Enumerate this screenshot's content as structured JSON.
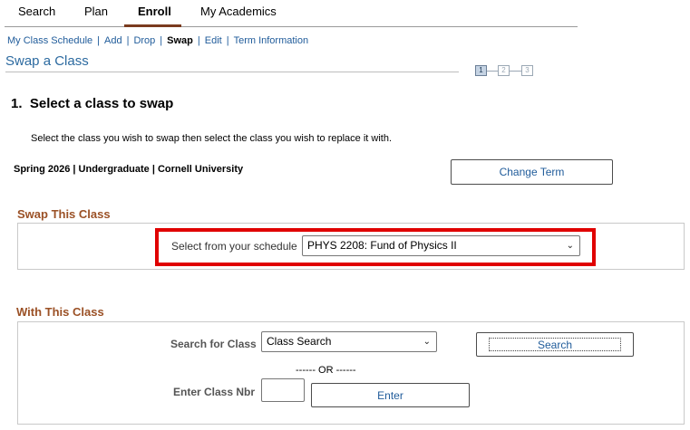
{
  "tabs": [
    {
      "label": "Search",
      "underline_char": "h"
    },
    {
      "label": "Plan"
    },
    {
      "label": "Enroll",
      "active": true
    },
    {
      "label": "My Academics"
    }
  ],
  "subnav": {
    "my_class_schedule": "My Class Schedule",
    "add": "Add",
    "drop": "Drop",
    "swap": "Swap",
    "edit": "Edit",
    "term_information": "Term Information",
    "separator": "|"
  },
  "page_title": "Swap a Class",
  "steps": [
    "1",
    "2",
    "3"
  ],
  "current_step": 1,
  "heading": "1.  Select a class to swap",
  "instruction": "Select the class you wish to swap then select the class you wish to replace it with.",
  "term_info": "Spring 2026 | Undergraduate | Cornell University",
  "change_term_button": "Change Term",
  "swap_section": {
    "label": "Swap This Class",
    "field_label": "Select from your schedule",
    "selected_value": "PHYS 2208: Fund of Physics II"
  },
  "with_section": {
    "label": "With This Class",
    "search_label": "Search for Class",
    "search_select_value": "Class Search",
    "search_button": "Search",
    "or_text": "------ OR ------",
    "class_nbr_label": "Enter Class Nbr",
    "class_nbr_value": "",
    "enter_button": "Enter"
  },
  "colors": {
    "tab_underline": "#7a3b1e",
    "link": "#1f5b9a",
    "section_label": "#9b5126",
    "highlight": "#e00000"
  }
}
